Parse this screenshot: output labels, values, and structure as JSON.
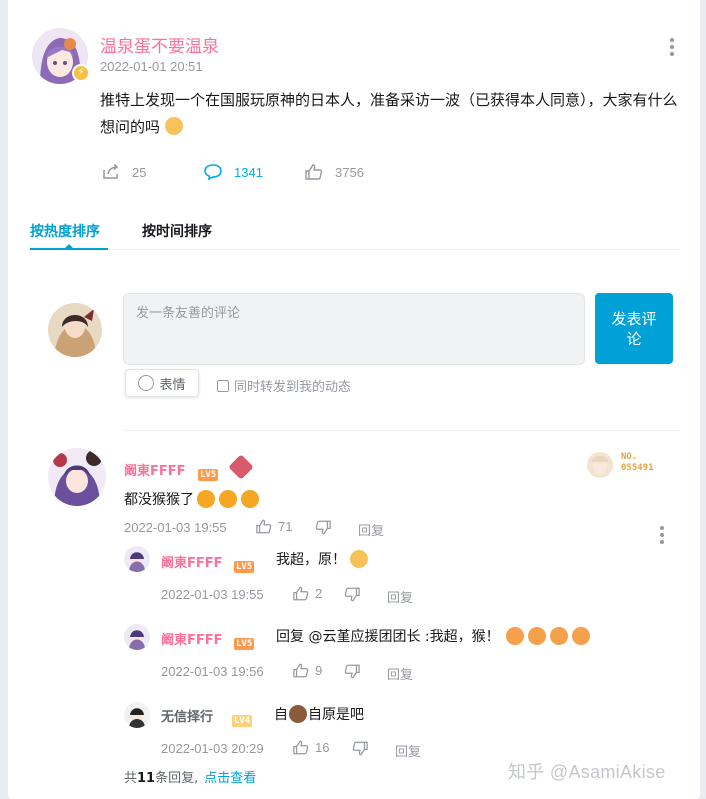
{
  "post": {
    "author": "温泉蛋不要温泉",
    "time": "2022-01-01 20:51",
    "content": "推特上发现一个在国服玩原神的日本人，准备采访一波（已获得本人同意），大家有什么想问的吗",
    "verified_badge_icon": "lightning-icon",
    "stats": {
      "forward": "25",
      "comments": "1341",
      "likes": "3756"
    }
  },
  "tabs": {
    "hot": "按热度排序",
    "time": "按时间排序"
  },
  "composer": {
    "placeholder": "发一条友善的评论",
    "send_label": "发表评论",
    "emoji_label": "表情",
    "forward_label": "同时转发到我的动态"
  },
  "comments": [
    {
      "user": "阚東FFFF",
      "level": "LV5",
      "text": "都没猴猴了",
      "time": "2022-01-03 19:55",
      "likes": "71",
      "reply_label": "回复",
      "fan_badge": "NO. 055491",
      "replies": [
        {
          "user": "阚東FFFF",
          "level": "LV5",
          "text": "我超，原！",
          "time": "2022-01-03 19:55",
          "likes": "2",
          "reply_label": "回复"
        },
        {
          "user": "阚東FFFF",
          "level": "LV5",
          "text": "回复 @云堇应援团团长 :我超，猴！",
          "time": "2022-01-03 19:56",
          "likes": "9",
          "reply_label": "回复"
        },
        {
          "user": "无信择行",
          "level": "LV4",
          "text_before": "自",
          "text_after": "自原是吧",
          "time": "2022-01-03 20:29",
          "likes": "16",
          "reply_label": "回复"
        }
      ],
      "total_prefix": "共",
      "total_count": "11",
      "total_suffix": "条回复,",
      "view_more": "点击查看"
    }
  ],
  "watermark": "知乎 @AsamiAkise",
  "colors": {
    "accent": "#00a1d6",
    "username_pink": "#fb7299",
    "meta_gray": "#9499a0"
  }
}
